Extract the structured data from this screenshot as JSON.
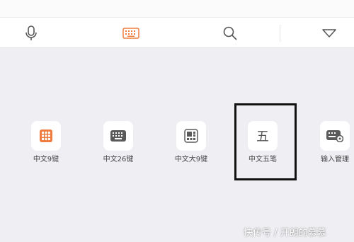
{
  "toolbar": {
    "buttons": [
      {
        "name": "microphone-icon"
      },
      {
        "name": "keyboard-icon",
        "active_color": "#f07b3f"
      },
      {
        "name": "search-icon"
      },
      {
        "name": "collapse-triangle-icon"
      }
    ]
  },
  "layouts": [
    {
      "label": "中文9键",
      "icon": "grid-9-icon",
      "color": "#f07b3f"
    },
    {
      "label": "中文26键",
      "icon": "keyboard-26-icon",
      "color": "#5a5a5a"
    },
    {
      "label": "中文大9键",
      "icon": "big-9-icon",
      "color": "#5a5a5a"
    },
    {
      "label": "中文五笔",
      "icon": "wubi-icon",
      "glyph": "五",
      "selected": true
    },
    {
      "label": "输入管理",
      "icon": "input-manage-icon",
      "color": "#5a5a5a"
    }
  ],
  "watermark": "快传号 / 开朗的慕慕"
}
